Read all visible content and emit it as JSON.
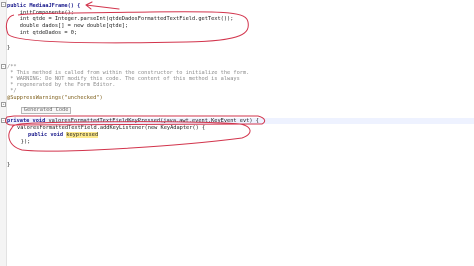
{
  "lines": {
    "l01": "public MediaaJFrame() {",
    "l02": "    initComponents();",
    "l03": "    int qtde = Integer.parseInt(qtdeDadosFormattedTextField.getText());",
    "l04": "    double dados[] = new double[qtde];",
    "l05": "    int qtdeDados = 0;",
    "l06": "}",
    "l07": "/**",
    "l08": " * This method is called from within the constructor to initialize the form.",
    "l09": " * WARNING: Do NOT modify this code. The content of this method is always",
    "l10": " * regenerated by the Form Editor.",
    "l11": " */",
    "l12": "@SuppressWarnings(\"unchecked\")",
    "l13": "Generated Code",
    "l14_kw": "private void ",
    "l14_rest": "valoresFormattedTextFieldKeyPressed(java.awt.event.KeyEvent evt) {",
    "l15": "valoresFormattedTextField.addKeyListener(new KeyAdapter() {",
    "l16_kw": "public void ",
    "l16_rest": "keypressed",
    "l17": "    });",
    "l18": "}"
  },
  "colors": {
    "annotation_pen": "#d2344c",
    "keyword": "#1a1a8c",
    "comment": "#8a8a8a",
    "string": "#b31d1d"
  }
}
